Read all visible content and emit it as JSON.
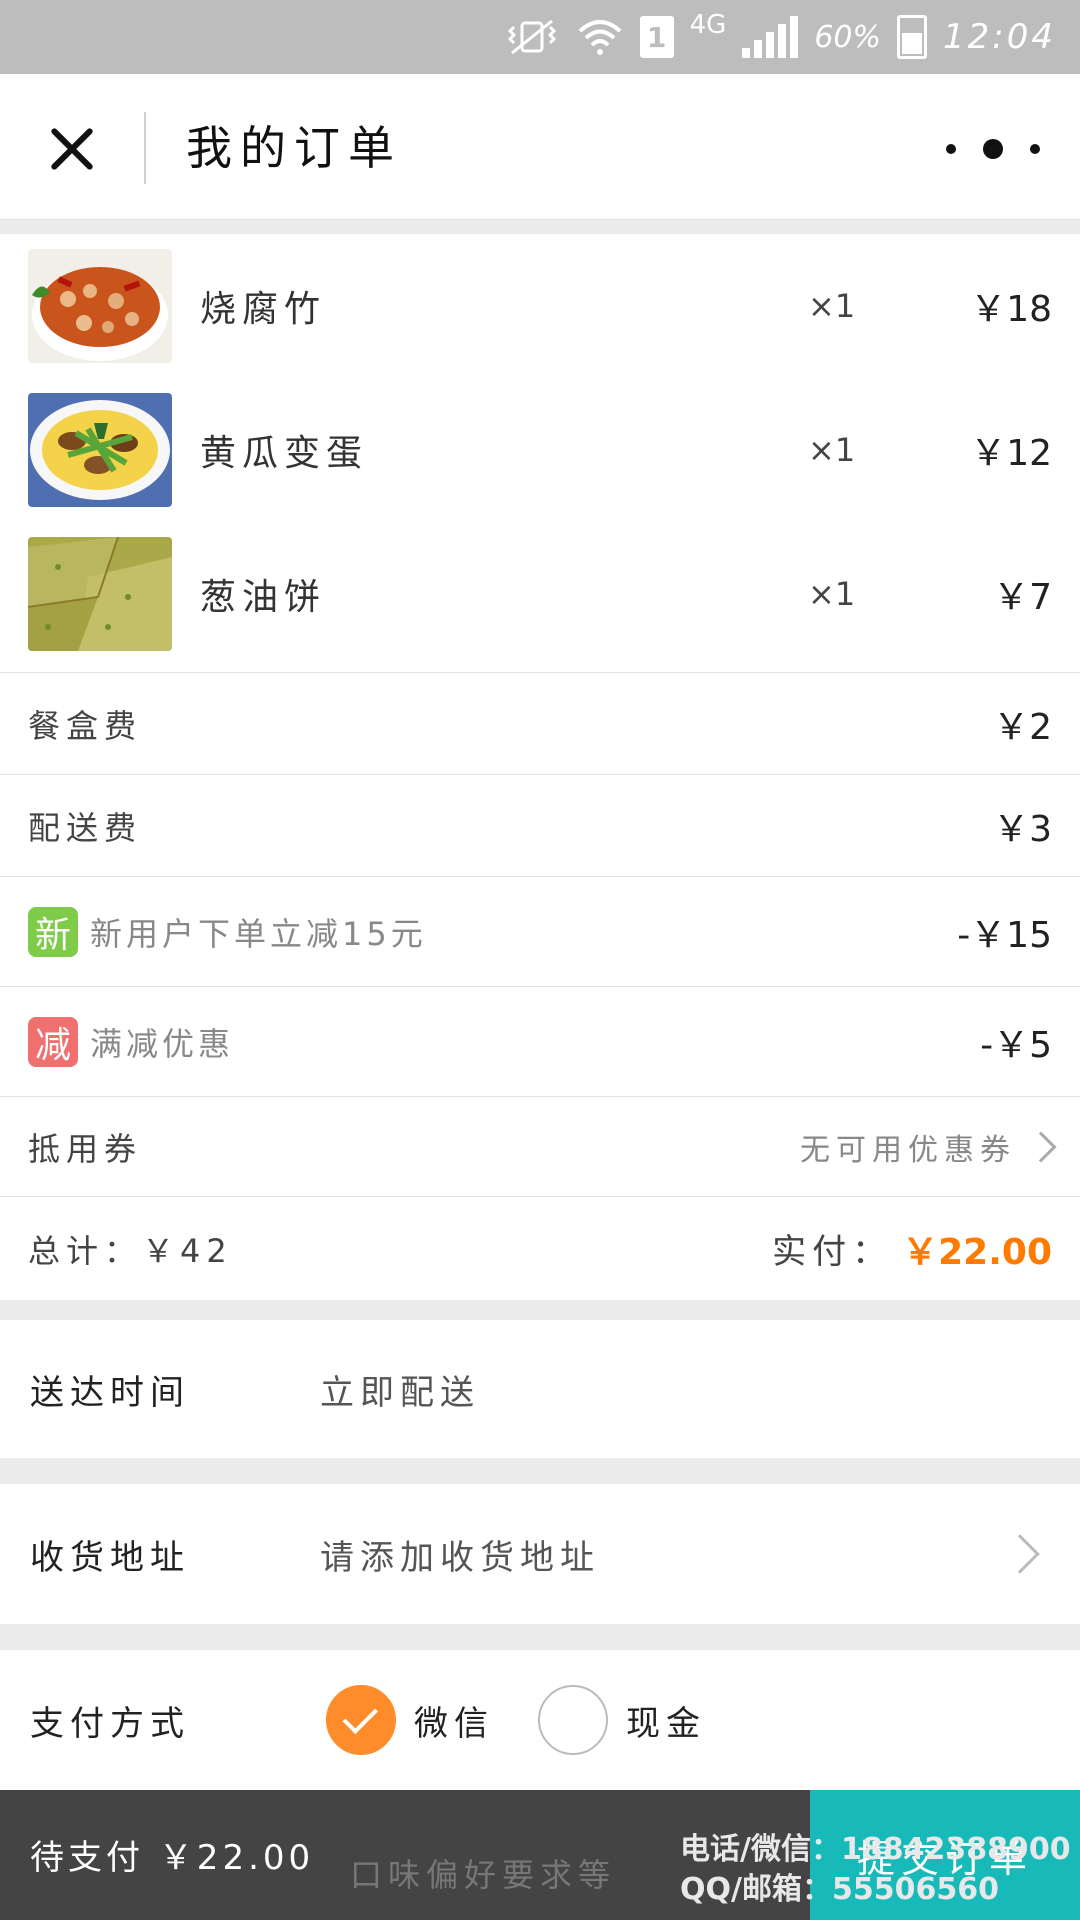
{
  "status_bar": {
    "network": "4G",
    "sim": "1",
    "battery": "60%",
    "time": "12:04"
  },
  "header": {
    "title": "我的订单"
  },
  "order": {
    "items": [
      {
        "name": "烧腐竹",
        "qty": "×1",
        "price": "￥18"
      },
      {
        "name": "黄瓜变蛋",
        "qty": "×1",
        "price": "￥12"
      },
      {
        "name": "葱油饼",
        "qty": "×1",
        "price": "￥7"
      }
    ],
    "box_fee": {
      "label": "餐盒费",
      "value": "￥2"
    },
    "delivery_fee": {
      "label": "配送费",
      "value": "￥3"
    },
    "promo_new": {
      "badge": "新",
      "label": "新用户下单立减15元",
      "value": "-￥15"
    },
    "promo_discount": {
      "badge": "减",
      "label": "满减优惠",
      "value": "-￥5"
    },
    "coupon": {
      "label": "抵用券",
      "value": "无可用优惠券"
    },
    "total": {
      "label": "总计：￥42",
      "pay_label": "实付：",
      "pay_amount": "￥22.00"
    }
  },
  "delivery_time": {
    "label": "送达时间",
    "value": "立即配送"
  },
  "address": {
    "label": "收货地址",
    "value": "请添加收货地址"
  },
  "payment": {
    "label": "支付方式",
    "options": [
      {
        "label": "微信",
        "selected": true
      },
      {
        "label": "现金",
        "selected": false
      }
    ]
  },
  "bottom_bar": {
    "pending": "待支付 ￥22.00",
    "note_placeholder": "口味偏好要求等",
    "submit": "提交订单",
    "watermark_line1": "电话/微信：18842388900",
    "watermark_line2": "QQ/邮箱：55506560"
  },
  "colors": {
    "accent": "#ff8c2b",
    "submit": "#17b9b9",
    "discount": "#e60012",
    "pay_amount": "#ff7a00"
  }
}
